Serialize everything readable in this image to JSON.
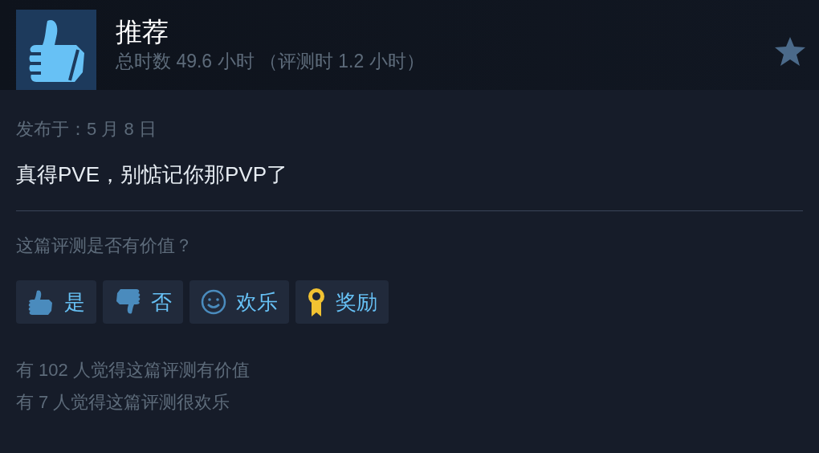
{
  "review": {
    "verdict": "推荐",
    "hours": "总时数 49.6 小时 （评测时 1.2 小时）",
    "posted": "发布于：5 月 8 日",
    "text": "真得PVE，别惦记你那PVP了"
  },
  "helpful": {
    "question": "这篇评测是否有价值？",
    "buttons": [
      {
        "kind": "yes",
        "label": "是"
      },
      {
        "kind": "no",
        "label": "否"
      },
      {
        "kind": "funny",
        "label": "欢乐"
      },
      {
        "kind": "award",
        "label": "奖励"
      }
    ],
    "counts": [
      "有 102 人觉得这篇评测有价值",
      "有 7 人觉得这篇评测很欢乐"
    ]
  }
}
